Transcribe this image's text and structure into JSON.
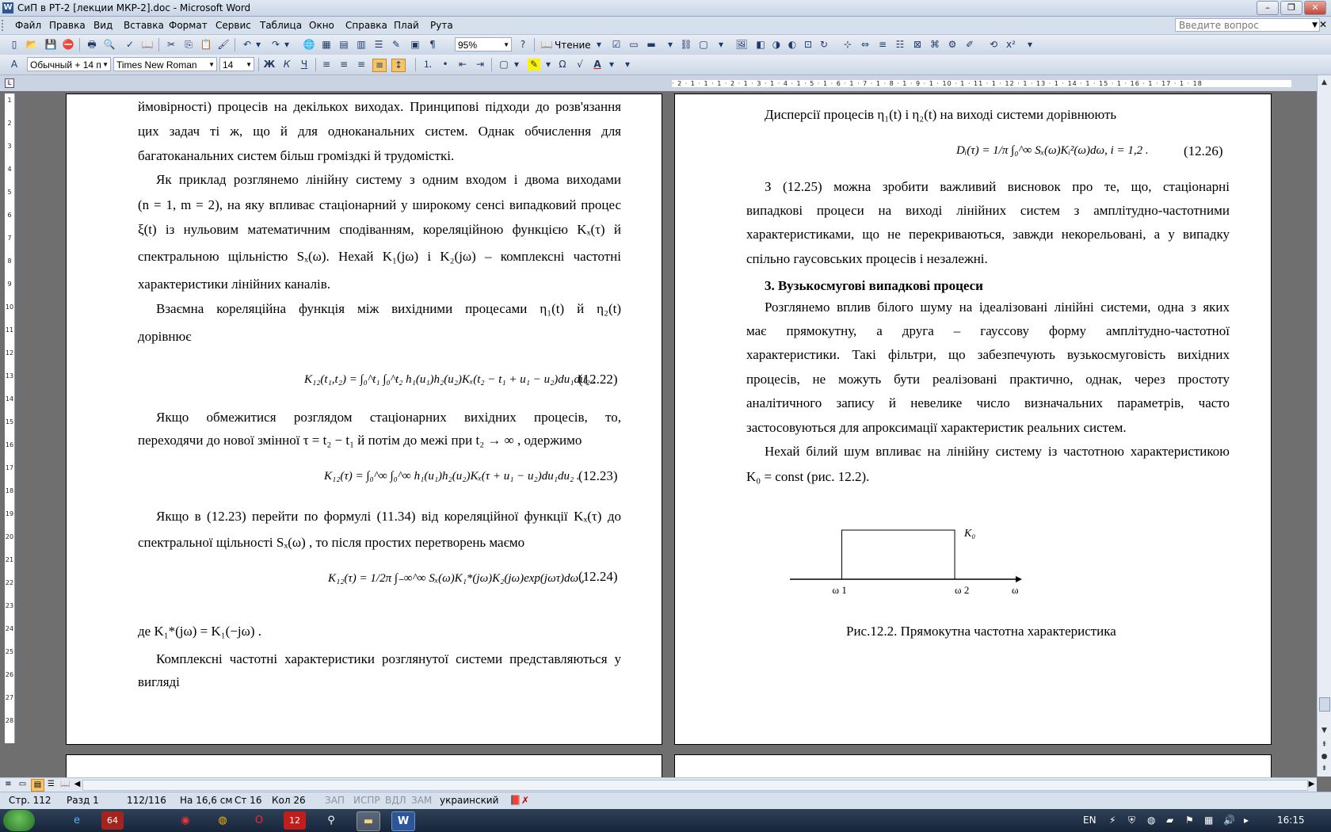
{
  "window": {
    "title": "СиП в РТ-2 [лекции МКР-2].doc - Microsoft Word",
    "icon": "word-icon"
  },
  "menu": [
    "Файл",
    "Правка",
    "Вид",
    "Вставка",
    "Формат",
    "Сервис",
    "Таблица",
    "Окно",
    "Справка",
    "Плай",
    "Рута"
  ],
  "ask_placeholder": "Введите вопрос",
  "toolbar": {
    "zoom": "95%",
    "reading": "Чтение",
    "style": "Обычный + 14 п",
    "font": "Times New Roman",
    "size": "14"
  },
  "ruler_h": "· 2 · 1 · 1 · 1 · 2 · 1 · 3 · 1 · 4 · 1 · 5 · 1 · 6 · 1 · 7 · 1 · 8 · 1 · 9 · 1 · 10 · 1 · 11 · 1 · 12 · 1 · 13 · 1 · 14 · 1 · 15 · 1 · 16 · 1 · 17 · 1 · 18",
  "ruler_v": [
    "1",
    "2",
    "3",
    "4",
    "5",
    "6",
    "7",
    "8",
    "9",
    "10",
    "11",
    "12",
    "13",
    "14",
    "15",
    "16",
    "17",
    "18",
    "19",
    "20",
    "21",
    "22",
    "23",
    "24",
    "25",
    "26",
    "27",
    "28"
  ],
  "left_page": {
    "p1": [
      "ймовірності) процесів на декількох виходах. Принципові підходи до розв'язання",
      "цих задач ті ж, що й для одноканальних систем. Однак обчислення для",
      "багатоканальних систем більш громіздкі й трудомісткі."
    ],
    "p2": [
      "Як приклад розглянемо лінійну систему з одним входом і двома виходами",
      "(n = 1, m = 2), на яку впливає стаціонарний у широкому сенсі випадковий процес",
      "ξ(t) із нульовим математичним сподіванням, кореляційною функцією Kₓ(τ) й",
      "спектральною щільністю Sₓ(ω). Нехай K₁(jω) і K₂(jω) – комплексні частотні",
      "характеристики лінійних каналів."
    ],
    "p3": [
      "Взаємна кореляційна функція між вихідними процесами η₁(t) й η₂(t)",
      "дорівнює"
    ],
    "eq1": "K₁₂(t₁,t₂) = ∫₀^t₁ ∫₀^t₂ h₁(u₁)h₂(u₂)Kₓ(t₂ − t₁ + u₁ − u₂)du₁du₂ .",
    "eq1_num": "(12.22)",
    "p4": [
      "Якщо обмежитися розглядом стаціонарних вихідних процесів, то,",
      "переходячи до нової змінної τ = t₂ − t₁ й потім до межі при t₂ → ∞ , одержимо"
    ],
    "eq2": "K₁₂(τ) = ∫₀^∞ ∫₀^∞ h₁(u₁)h₂(u₂)Kₓ(τ + u₁ − u₂)du₁du₂ .",
    "eq2_num": "(12.23)",
    "p5": [
      "Якщо в (12.23) перейти по формулі (11.34) від кореляційної функції Kₓ(τ) до",
      "спектральної щільності Sₓ(ω) , то після простих перетворень маємо"
    ],
    "eq3": "K₁₂(τ) = 1/2π ∫₋∞^∞ Sₓ(ω)K₁*(jω)K₂(jω)exp(jωτ)dω ,",
    "eq3_num": "(12.24)",
    "p6": "де K₁*(jω) = K₁(−jω) .",
    "p7": [
      "Комплексні частотні характеристики розглянутої системи представляються у",
      "вигляді"
    ]
  },
  "right_page": {
    "p1": "Дисперсії процесів η₁(t) і η₂(t) на виході системи дорівнюють",
    "eq1": "Dᵢ(τ) = 1/π ∫₀^∞ Sₓ(ω)Kᵢ²(ω)dω,   i = 1,2 .",
    "eq1_num": "(12.26)",
    "p2": [
      "З (12.25) можна зробити важливий висновок про те, що, стаціонарні",
      "випадкові процеси на виході лінійних систем з амплітудно-частотними",
      "характеристиками, що не перекриваються, завжди некорельовані, а у випадку",
      "спільно гаусовських процесів і незалежні."
    ],
    "heading": "3. Вузькосмугові випадкові процеси",
    "p3": [
      "Розглянемо вплив білого шуму на ідеалізовані лінійні системи, одна з яких",
      "має прямокутну, а друга – гауссову форму амплітудно-частотної",
      "характеристики. Такі фільтри, що забезпечують вузькосмуговість вихідних",
      "процесів, не можуть бути реалізовані практично, однак, через простоту",
      "аналітичного запису й невелике число визначальних параметрів, часто",
      "застосовуються для апроксимації характеристик реальних систем."
    ],
    "p4": [
      "Нехай білий шум впливає на лінійну систему із частотною характеристикою",
      "K₀ = const  (рис. 12.2)."
    ],
    "figure": {
      "k0": "K₀",
      "w1": "ω 1",
      "w2": "ω 2",
      "w": "ω",
      "level": 1.0,
      "w1_pos": 0.23,
      "w2_pos": 0.73
    },
    "caption": "Рис.12.2. Прямокутна частотна характеристика"
  },
  "status": {
    "page": "Стр. 112",
    "section": "Разд 1",
    "pages": "112/116",
    "at": "На 16,6 см",
    "line": "Ст 16",
    "col": "Кол 26",
    "rec": "ЗАП",
    "trk": "ИСПР",
    "ext": "ВДЛ",
    "ovr": "ЗАМ",
    "lang": "украинский"
  },
  "taskbar": {
    "lang": "EN",
    "time": "16:15",
    "apps": [
      "ie-icon",
      "badge-64",
      "opera-red",
      "chrome-icon",
      "opera-icon",
      "app-12",
      "usb-icon",
      "folder-icon",
      "word-icon"
    ]
  }
}
